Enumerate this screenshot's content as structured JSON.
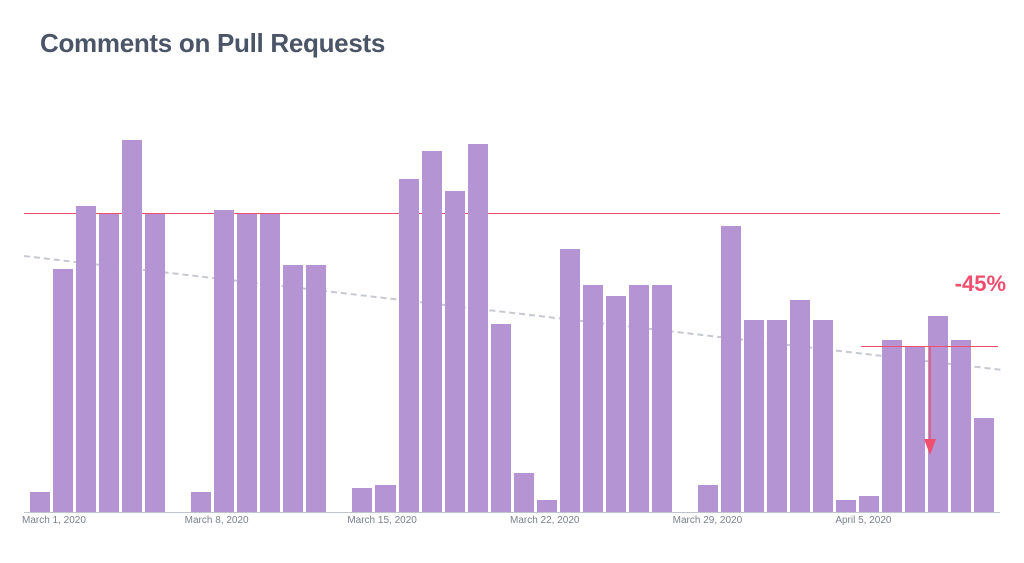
{
  "chart_data": {
    "type": "bar",
    "title": "Comments on Pull Requests",
    "categories": [
      "2020-03-01",
      "2020-03-02",
      "2020-03-03",
      "2020-03-04",
      "2020-03-05",
      "2020-03-06",
      "2020-03-07",
      "2020-03-08",
      "2020-03-09",
      "2020-03-10",
      "2020-03-11",
      "2020-03-12",
      "2020-03-13",
      "2020-03-14",
      "2020-03-15",
      "2020-03-16",
      "2020-03-17",
      "2020-03-18",
      "2020-03-19",
      "2020-03-20",
      "2020-03-21",
      "2020-03-22",
      "2020-03-23",
      "2020-03-24",
      "2020-03-25",
      "2020-03-26",
      "2020-03-27",
      "2020-03-28",
      "2020-03-29",
      "2020-03-30",
      "2020-03-31",
      "2020-04-01",
      "2020-04-02",
      "2020-04-03",
      "2020-04-04",
      "2020-04-05",
      "2020-04-06",
      "2020-04-07",
      "2020-04-08",
      "2020-04-09",
      "2020-04-10",
      "2020-04-11"
    ],
    "values": [
      5,
      62,
      78,
      76,
      95,
      76,
      0,
      5,
      77,
      76,
      76,
      63,
      63,
      0,
      6,
      7,
      85,
      92,
      82,
      94,
      48,
      10,
      3,
      67,
      58,
      55,
      58,
      58,
      0,
      7,
      73,
      49,
      49,
      54,
      49,
      3,
      4,
      44,
      42,
      50,
      44,
      24
    ],
    "x_tick_labels": [
      {
        "index": 0,
        "label": "March 1, 2020"
      },
      {
        "index": 7,
        "label": "March 8, 2020"
      },
      {
        "index": 14,
        "label": "March 15, 2020"
      },
      {
        "index": 21,
        "label": "March 22, 2020"
      },
      {
        "index": 28,
        "label": "March 29, 2020"
      },
      {
        "index": 35,
        "label": "April 5, 2020"
      }
    ],
    "xlabel": "",
    "ylabel": "",
    "ylim": [
      0,
      100
    ],
    "reference_lines": {
      "baseline_full_width": 76,
      "recent_weekly_avg": 42
    },
    "trend": {
      "start_value": 65,
      "end_value": 36
    },
    "annotation": {
      "text": "-45%",
      "color": "#f04e6e"
    }
  }
}
